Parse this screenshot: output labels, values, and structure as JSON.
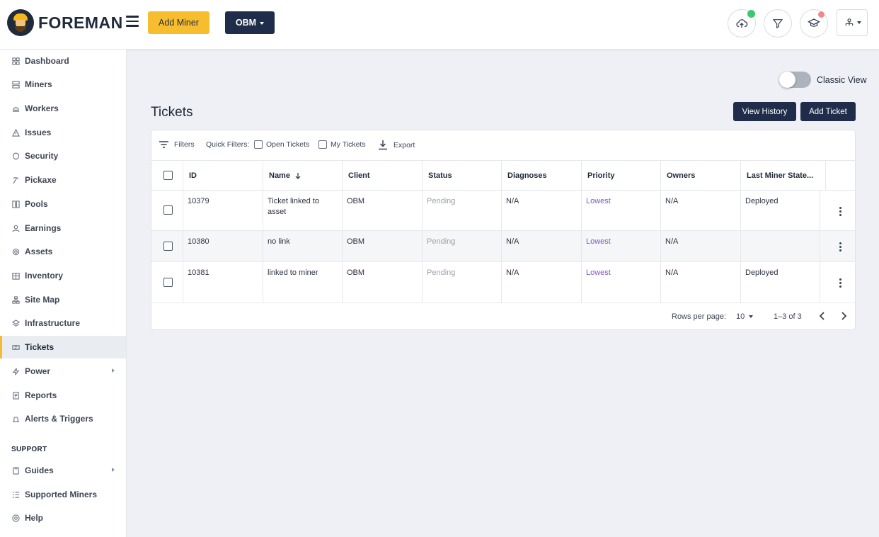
{
  "app": {
    "logo_text": "FOREMAN",
    "add_miner_label": "Add Miner",
    "org_label": "OBM",
    "status_colors": {
      "cloud_dot": "#3cc86b",
      "notif_dot": "#f08a8a"
    }
  },
  "sidebar": {
    "items": [
      {
        "label": "Dashboard",
        "icon": "grid-icon"
      },
      {
        "label": "Miners",
        "icon": "server-icon"
      },
      {
        "label": "Workers",
        "icon": "workers-icon"
      },
      {
        "label": "Issues",
        "icon": "warning-icon"
      },
      {
        "label": "Security",
        "icon": "shield-icon"
      },
      {
        "label": "Pickaxe",
        "icon": "pickaxe-icon"
      },
      {
        "label": "Pools",
        "icon": "pools-icon"
      },
      {
        "label": "Earnings",
        "icon": "earnings-icon"
      },
      {
        "label": "Assets",
        "icon": "assets-icon"
      },
      {
        "label": "Inventory",
        "icon": "inventory-icon"
      },
      {
        "label": "Site Map",
        "icon": "sitemap-icon"
      },
      {
        "label": "Infrastructure",
        "icon": "layers-icon"
      },
      {
        "label": "Tickets",
        "icon": "ticket-icon"
      },
      {
        "label": "Power",
        "icon": "bolt-icon"
      },
      {
        "label": "Reports",
        "icon": "report-icon"
      },
      {
        "label": "Alerts & Triggers",
        "icon": "bell-icon"
      }
    ],
    "support_label": "SUPPORT",
    "support_items": [
      {
        "label": "Guides",
        "icon": "book-icon"
      },
      {
        "label": "Supported Miners",
        "icon": "list-icon"
      },
      {
        "label": "Help",
        "icon": "help-icon"
      }
    ]
  },
  "page": {
    "classic_view_label": "Classic View",
    "title": "Tickets",
    "view_history_label": "View History",
    "add_ticket_label": "Add Ticket"
  },
  "toolbar": {
    "filters_label": "Filters",
    "quick_filters_label": "Quick Filters:",
    "open_tickets_label": "Open Tickets",
    "my_tickets_label": "My Tickets",
    "export_label": "Export"
  },
  "table": {
    "headers": {
      "id": "ID",
      "name": "Name",
      "client": "Client",
      "status": "Status",
      "diagnoses": "Diagnoses",
      "priority": "Priority",
      "owners": "Owners",
      "last_miner_state": "Last Miner State..."
    },
    "rows": [
      {
        "id": "10379",
        "name": "Ticket linked to asset",
        "client": "OBM",
        "status": "Pending",
        "diagnoses": "N/A",
        "priority": "Lowest",
        "owners": "N/A",
        "last_miner_state": "Deployed"
      },
      {
        "id": "10380",
        "name": "no link",
        "client": "OBM",
        "status": "Pending",
        "diagnoses": "N/A",
        "priority": "Lowest",
        "owners": "N/A",
        "last_miner_state": ""
      },
      {
        "id": "10381",
        "name": "linked to miner",
        "client": "OBM",
        "status": "Pending",
        "diagnoses": "N/A",
        "priority": "Lowest",
        "owners": "N/A",
        "last_miner_state": "Deployed"
      }
    ],
    "footer": {
      "rows_per_page_label": "Rows per page:",
      "rows_per_page_value": "10",
      "range_label": "1–3 of 3"
    }
  }
}
